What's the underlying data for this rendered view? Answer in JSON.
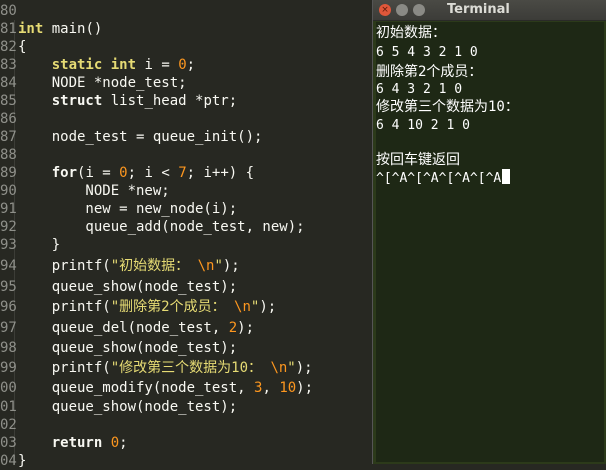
{
  "editor": {
    "line_numbers": [
      "80",
      "81",
      "82",
      "83",
      "84",
      "85",
      "86",
      "87",
      "88",
      "89",
      "90",
      "91",
      "92",
      "93",
      "94",
      "95",
      "96",
      "97",
      "98",
      "99",
      "00",
      "01",
      "02",
      "03",
      "04"
    ],
    "lines": {
      "l80": "",
      "l81_a": "int",
      "l81_b": " main()",
      "l82": "{",
      "l83_a": "    ",
      "l83_b": "static",
      "l83_c": " ",
      "l83_d": "int",
      "l83_e": " i = ",
      "l83_f": "0",
      "l83_g": ";",
      "l84": "    NODE *node_test;",
      "l85_a": "    ",
      "l85_b": "struct",
      "l85_c": " list_head *ptr;",
      "l86": "",
      "l87": "    node_test = queue_init();",
      "l88": "",
      "l89_a": "    ",
      "l89_b": "for",
      "l89_c": "(i = ",
      "l89_d": "0",
      "l89_e": "; i < ",
      "l89_f": "7",
      "l89_g": "; i++) {",
      "l90": "        NODE *new;",
      "l91": "        new = new_node(i);",
      "l92": "        queue_add(node_test, new);",
      "l93": "    }",
      "l94_a": "    printf(",
      "l94_b": "\"初始数据： ",
      "l94_c": "\\n",
      "l94_d": "\"",
      "l94_e": ");",
      "l95": "    queue_show(node_test);",
      "l96_a": "    printf(",
      "l96_b": "\"删除第2个成员： ",
      "l96_c": "\\n",
      "l96_d": "\"",
      "l96_e": ");",
      "l97_a": "    queue_del(node_test, ",
      "l97_b": "2",
      "l97_c": ");",
      "l98": "    queue_show(node_test);",
      "l99_a": "    printf(",
      "l99_b": "\"修改第三个数据为10： ",
      "l99_c": "\\n",
      "l99_d": "\"",
      "l99_e": ");",
      "l00_a": "    queue_modify(node_test, ",
      "l00_b": "3",
      "l00_c": ", ",
      "l00_d": "10",
      "l00_e": ");",
      "l01": "    queue_show(node_test);",
      "l02": "",
      "l03_a": "    ",
      "l03_b": "return",
      "l03_c": " ",
      "l03_d": "0",
      "l03_e": ";",
      "l04": "}"
    }
  },
  "terminal": {
    "title": "Terminal",
    "close_glyph": "×",
    "output": [
      "初始数据：",
      "6 5 4 3 2 1 0",
      "删除第2个成员：",
      "6 4 3 2 1 0",
      "修改第三个数据为10：",
      "6 4 10 2 1 0",
      "",
      "按回车键返回",
      "^[^A^[^A^[^A^[^A"
    ]
  },
  "colors": {
    "editor_bg": "#272822",
    "terminal_bg": "#1e2815",
    "string": "#e6db74",
    "number": "#fd971f"
  }
}
